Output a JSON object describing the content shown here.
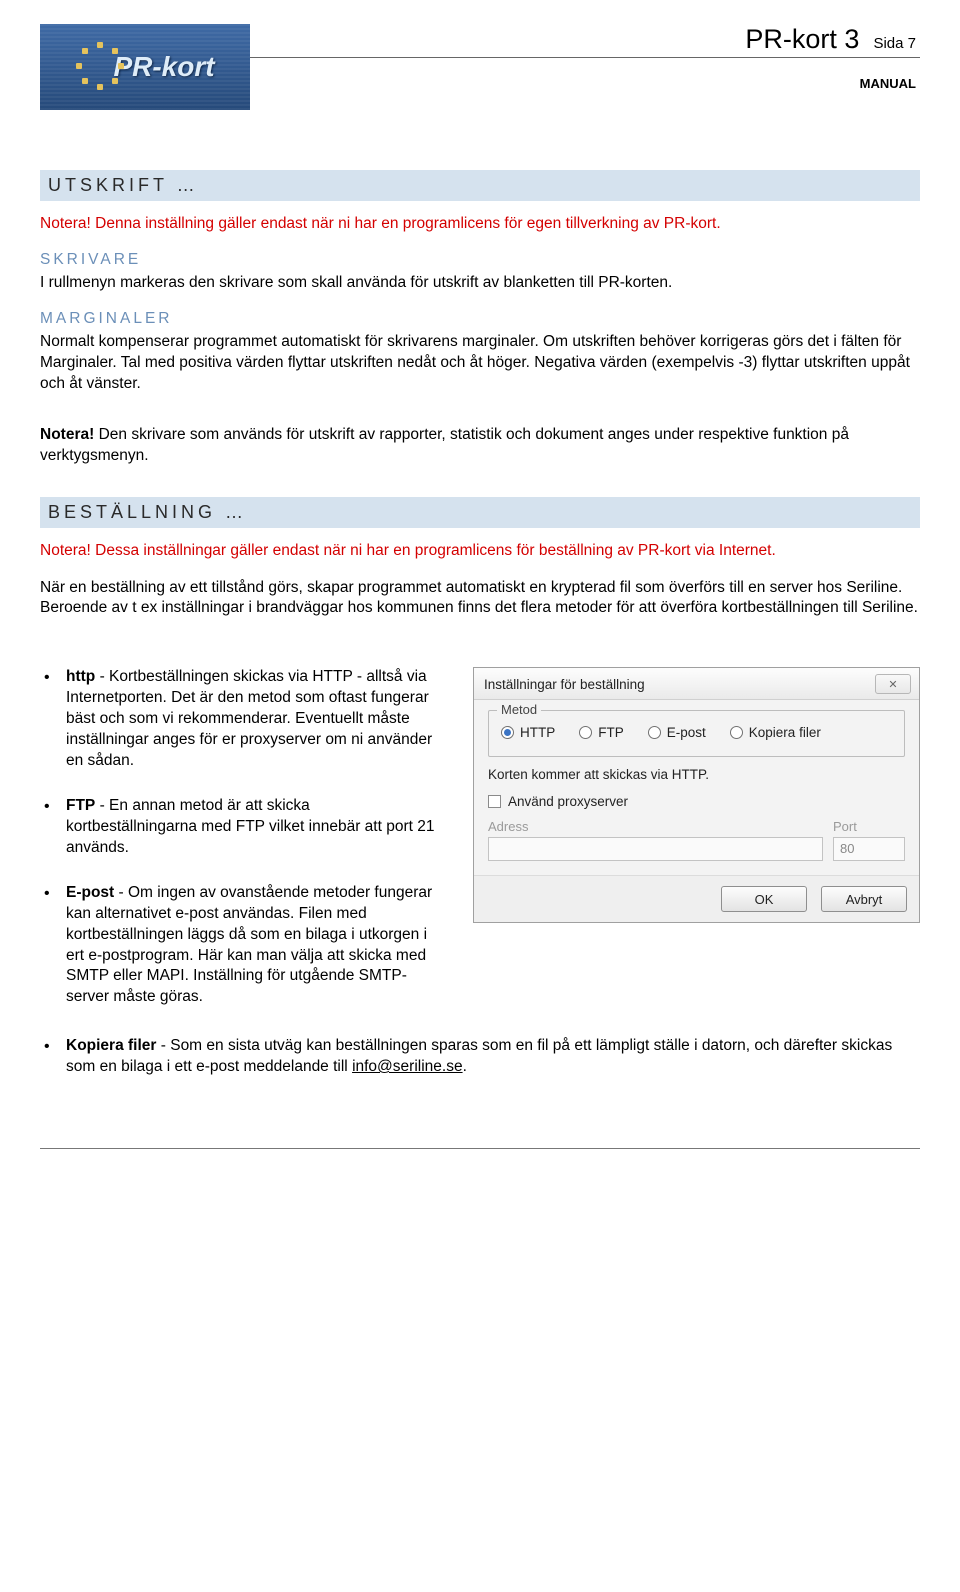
{
  "header": {
    "logo_text": "PR-kort",
    "title": "PR-kort 3",
    "page_label": "Sida 7",
    "manual": "MANUAL"
  },
  "section_utskrift": {
    "heading": "UTSKRIFT …",
    "note": "Notera! Denna inställning gäller endast när ni har en programlicens för egen tillverkning av PR-kort.",
    "skrivare_head": "SKRIVARE",
    "skrivare_body": "I rullmenyn markeras den skrivare som skall använda för utskrift av blanketten till PR-korten.",
    "marginaler_head": "MARGINALER",
    "marginaler_body": "Normalt kompenserar programmet automatiskt för skrivarens marginaler. Om utskriften behöver korrigeras görs det i fälten för Marginaler. Tal med positiva värden flyttar utskriften nedåt och åt höger. Negativa värden (exempelvis -3) flyttar utskriften uppåt och åt vänster.",
    "note2_bold": "Notera!",
    "note2_text": " Den skrivare som används för utskrift av rapporter, statistik och dokument anges under respektive funktion på verktygsmenyn."
  },
  "section_bestallning": {
    "heading": "BESTÄLLNING …",
    "note": "Notera! Dessa inställningar gäller endast när ni har en programlicens för beställning av PR-kort via Internet.",
    "intro": "När en beställning av ett tillstånd görs, skapar programmet automatiskt en krypterad fil som överförs till en server hos Seriline. Beroende av t ex inställningar i brandväggar hos kommunen finns det flera metoder för att överföra kortbeställningen till Seriline.",
    "bullets": [
      {
        "bold": "http",
        "text": " - Kortbeställningen skickas via HTTP - alltså via Internetporten. Det är den metod som oftast fungerar bäst och som vi rekommenderar. Eventuellt måste inställningar anges för er proxyserver om ni använder en sådan."
      },
      {
        "bold": "FTP",
        "text": " - En annan metod är att skicka kortbeställningarna med FTP vilket innebär att port 21 används."
      },
      {
        "bold": "E-post",
        "text": " - Om ingen av ovanstående metoder fungerar kan alternativet e-post användas. Filen med kortbeställningen läggs då som en bilaga i utkorgen i ert e-postprogram. Här kan man välja att skicka med SMTP eller MAPI. Inställning för utgående SMTP-server måste göras."
      }
    ],
    "bullet_full": {
      "bold": "Kopiera filer",
      "text": " - Som en sista utväg kan beställningen sparas som en fil på ett lämpligt ställe i datorn, och därefter skickas som en bilaga i ett e-post meddelande till ",
      "link": "info@seriline.se",
      "tail": "."
    }
  },
  "dialog": {
    "title": "Inställningar för beställning",
    "group_label": "Metod",
    "radios": [
      "HTTP",
      "FTP",
      "E-post",
      "Kopiera filer"
    ],
    "selected": 0,
    "info": "Korten kommer att skickas via HTTP.",
    "proxy_checkbox": "Använd proxyserver",
    "address_label": "Adress",
    "address_value": "",
    "port_label": "Port",
    "port_value": "80",
    "ok": "OK",
    "cancel": "Avbryt"
  }
}
